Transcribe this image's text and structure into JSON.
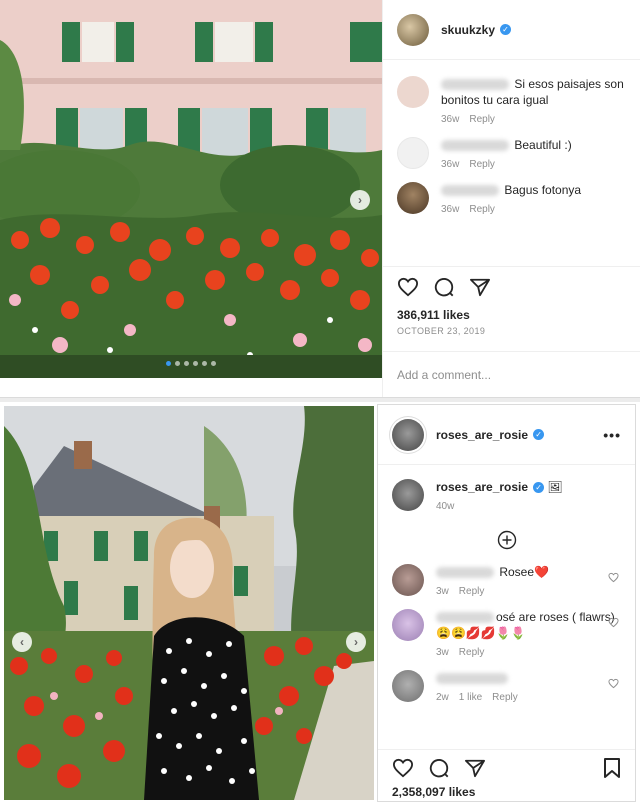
{
  "post1": {
    "username": "skuukzky",
    "comments": [
      {
        "text": "Si esos paisajes son bonitos tu cara igual",
        "time": "36w",
        "reply": "Reply"
      },
      {
        "text": "Beautiful :)",
        "time": "36w",
        "reply": "Reply"
      },
      {
        "text": "Bagus fotonya",
        "time": "36w",
        "reply": "Reply"
      }
    ],
    "likes": "386,911 likes",
    "date": "OCTOBER 23, 2019",
    "add_comment_placeholder": "Add a comment..."
  },
  "post2": {
    "username": "roses_are_rosie",
    "more_label": "•••",
    "caption": {
      "username": "roses_are_rosie",
      "emoji": "🖼",
      "time": "40w"
    },
    "load_more_icon": "plus-circle-icon",
    "comments": [
      {
        "text": "Rosee❤️",
        "time": "3w",
        "like_count": "",
        "reply": "Reply"
      },
      {
        "text": "osé are roses ( flawrs)",
        "text2": "😩😩💋💋🌷🌷",
        "time": "3w",
        "like_count": "",
        "reply": "Reply"
      },
      {
        "text": "",
        "time": "2w",
        "like_count": "1 like",
        "reply": "Reply"
      }
    ],
    "likes": "2,358,097 likes"
  },
  "colors": {
    "verified": "#3897f0",
    "meta_gray": "#8e8e8e",
    "border": "#dbdbdb"
  }
}
